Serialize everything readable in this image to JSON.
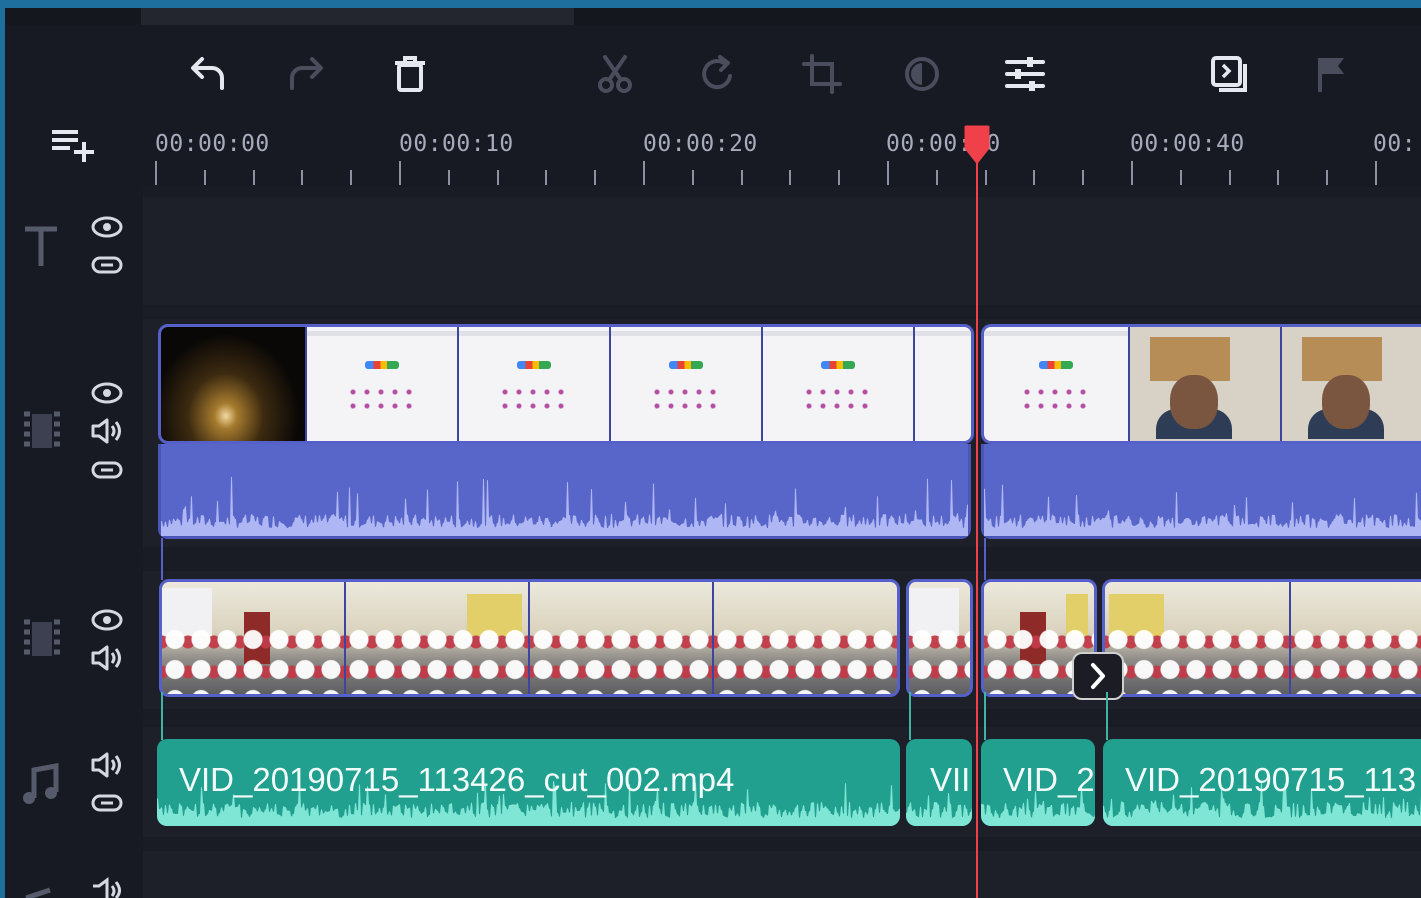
{
  "toolbar": {
    "buttons": [
      {
        "name": "undo",
        "icon": "undo-icon",
        "enabled": true
      },
      {
        "name": "redo",
        "icon": "redo-icon",
        "enabled": false
      },
      {
        "name": "delete",
        "icon": "trash-icon",
        "enabled": true
      },
      {
        "name": "split",
        "icon": "scissors-icon",
        "enabled": false
      },
      {
        "name": "rotate",
        "icon": "rotate-icon",
        "enabled": false
      },
      {
        "name": "crop",
        "icon": "crop-icon",
        "enabled": false
      },
      {
        "name": "color-adjust",
        "icon": "color-adjust-icon",
        "enabled": false
      },
      {
        "name": "clip-properties",
        "icon": "sliders-icon",
        "enabled": true
      },
      {
        "name": "transition",
        "icon": "transition-wizard-icon",
        "enabled": true
      },
      {
        "name": "marker",
        "icon": "flag-icon",
        "enabled": false
      }
    ]
  },
  "ruler": {
    "labels": [
      "00:00:00",
      "00:00:10",
      "00:00:20",
      "00:00:30",
      "00:00:40",
      "00:"
    ]
  },
  "tracks": {
    "title": {
      "icon": "text-track-icon",
      "controls": [
        "eye-icon",
        "link-icon"
      ]
    },
    "main_video": {
      "icon": "video-track-icon",
      "controls": [
        "eye-icon",
        "speaker-icon",
        "link-icon"
      ]
    },
    "overlay_video": {
      "icon": "video-track-icon",
      "controls": [
        "eye-icon",
        "speaker-icon"
      ]
    },
    "audio": {
      "icon": "music-note-icon",
      "controls": [
        "speaker-icon",
        "link-icon"
      ]
    },
    "extra": {
      "controls": [
        "speaker-icon"
      ]
    }
  },
  "audio_clips": [
    {
      "label": "VID_20190715_113426_cut_002.mp4"
    },
    {
      "label": "VII"
    },
    {
      "label": "VID_2"
    },
    {
      "label": "VID_20190715_113"
    }
  ],
  "colors": {
    "accent": "#1e6f9e",
    "video_clip": "#5a66cf",
    "audio_clip": "#21a08f",
    "playhead": "#f0404a"
  }
}
